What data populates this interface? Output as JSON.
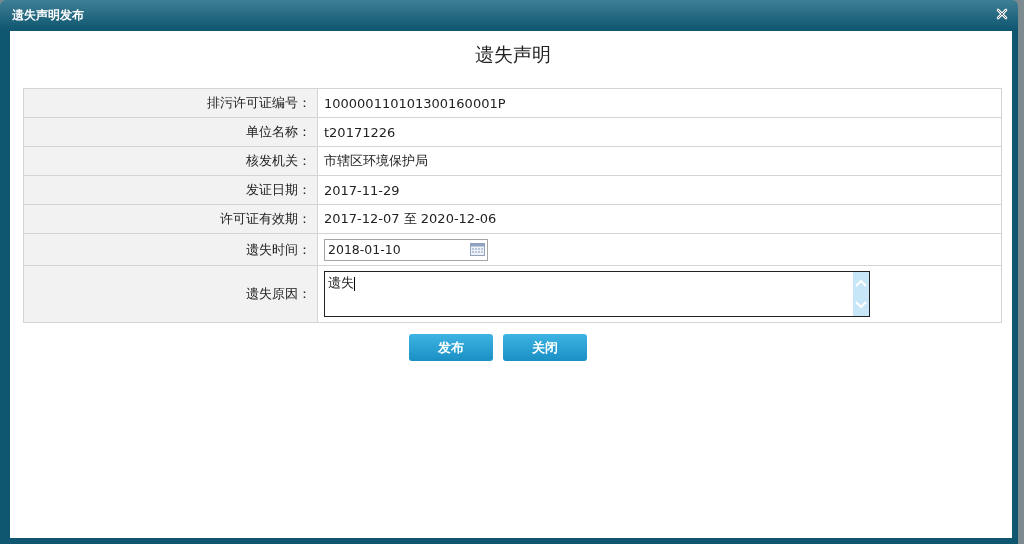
{
  "window": {
    "title": "遗失声明发布"
  },
  "heading": "遗失声明",
  "rows": [
    {
      "kind": "text",
      "label": "排污许可证编号：",
      "value": "100000110101300160001P"
    },
    {
      "kind": "text",
      "label": "单位名称：",
      "value": "t20171226"
    },
    {
      "kind": "text",
      "label": "核发机关：",
      "value": "市辖区环境保护局"
    },
    {
      "kind": "text",
      "label": "发证日期：",
      "value": "2017-11-29"
    },
    {
      "kind": "text",
      "label": "许可证有效期：",
      "value": "2017-12-07 至 2020-12-06"
    },
    {
      "kind": "date",
      "label": "遗失时间：",
      "value": "2018-01-10"
    },
    {
      "kind": "textarea",
      "label": "遗失原因：",
      "value": "遗失"
    }
  ],
  "buttons": [
    "发布",
    "关闭"
  ]
}
